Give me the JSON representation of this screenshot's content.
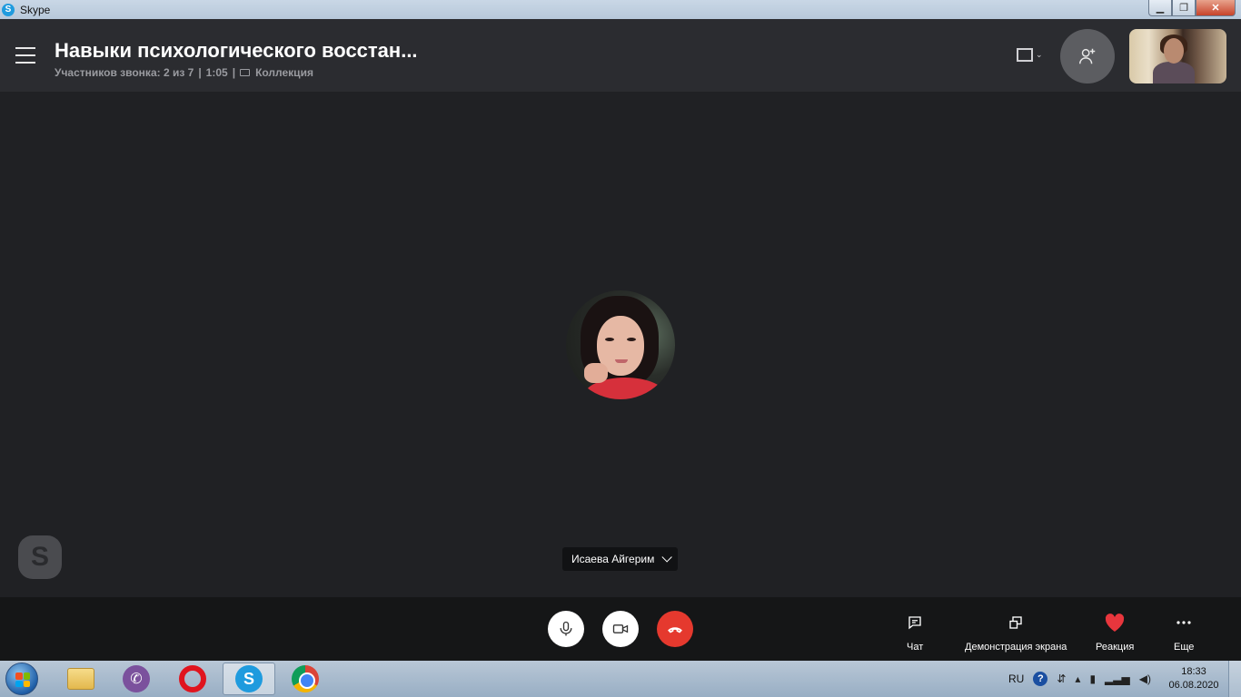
{
  "window": {
    "app_title": "Skype",
    "logo_letter": "S"
  },
  "header": {
    "title": "Навыки психологического восстан...",
    "meta_participants": "Участников звонка: 2 из 7",
    "meta_duration": "1:05",
    "meta_separator": "|",
    "meta_gallery": "Коллекция"
  },
  "stage": {
    "participant_name": "Исаева Айгерим",
    "watermark_letter": "S"
  },
  "controls": {
    "chat_label": "Чат",
    "share_label": "Демонстрация экрана",
    "reaction_label": "Реакция",
    "more_label": "Еще"
  },
  "taskbar": {
    "viber_glyph": "✆",
    "skype_letter": "S",
    "tray_lang": "RU",
    "tray_help": "?",
    "time": "18:33",
    "date": "06.08.2020"
  },
  "colors": {
    "end_call": "#e5392e",
    "reaction_heart": "#e8363d",
    "background": "#202124",
    "header": "#2b2c30"
  }
}
